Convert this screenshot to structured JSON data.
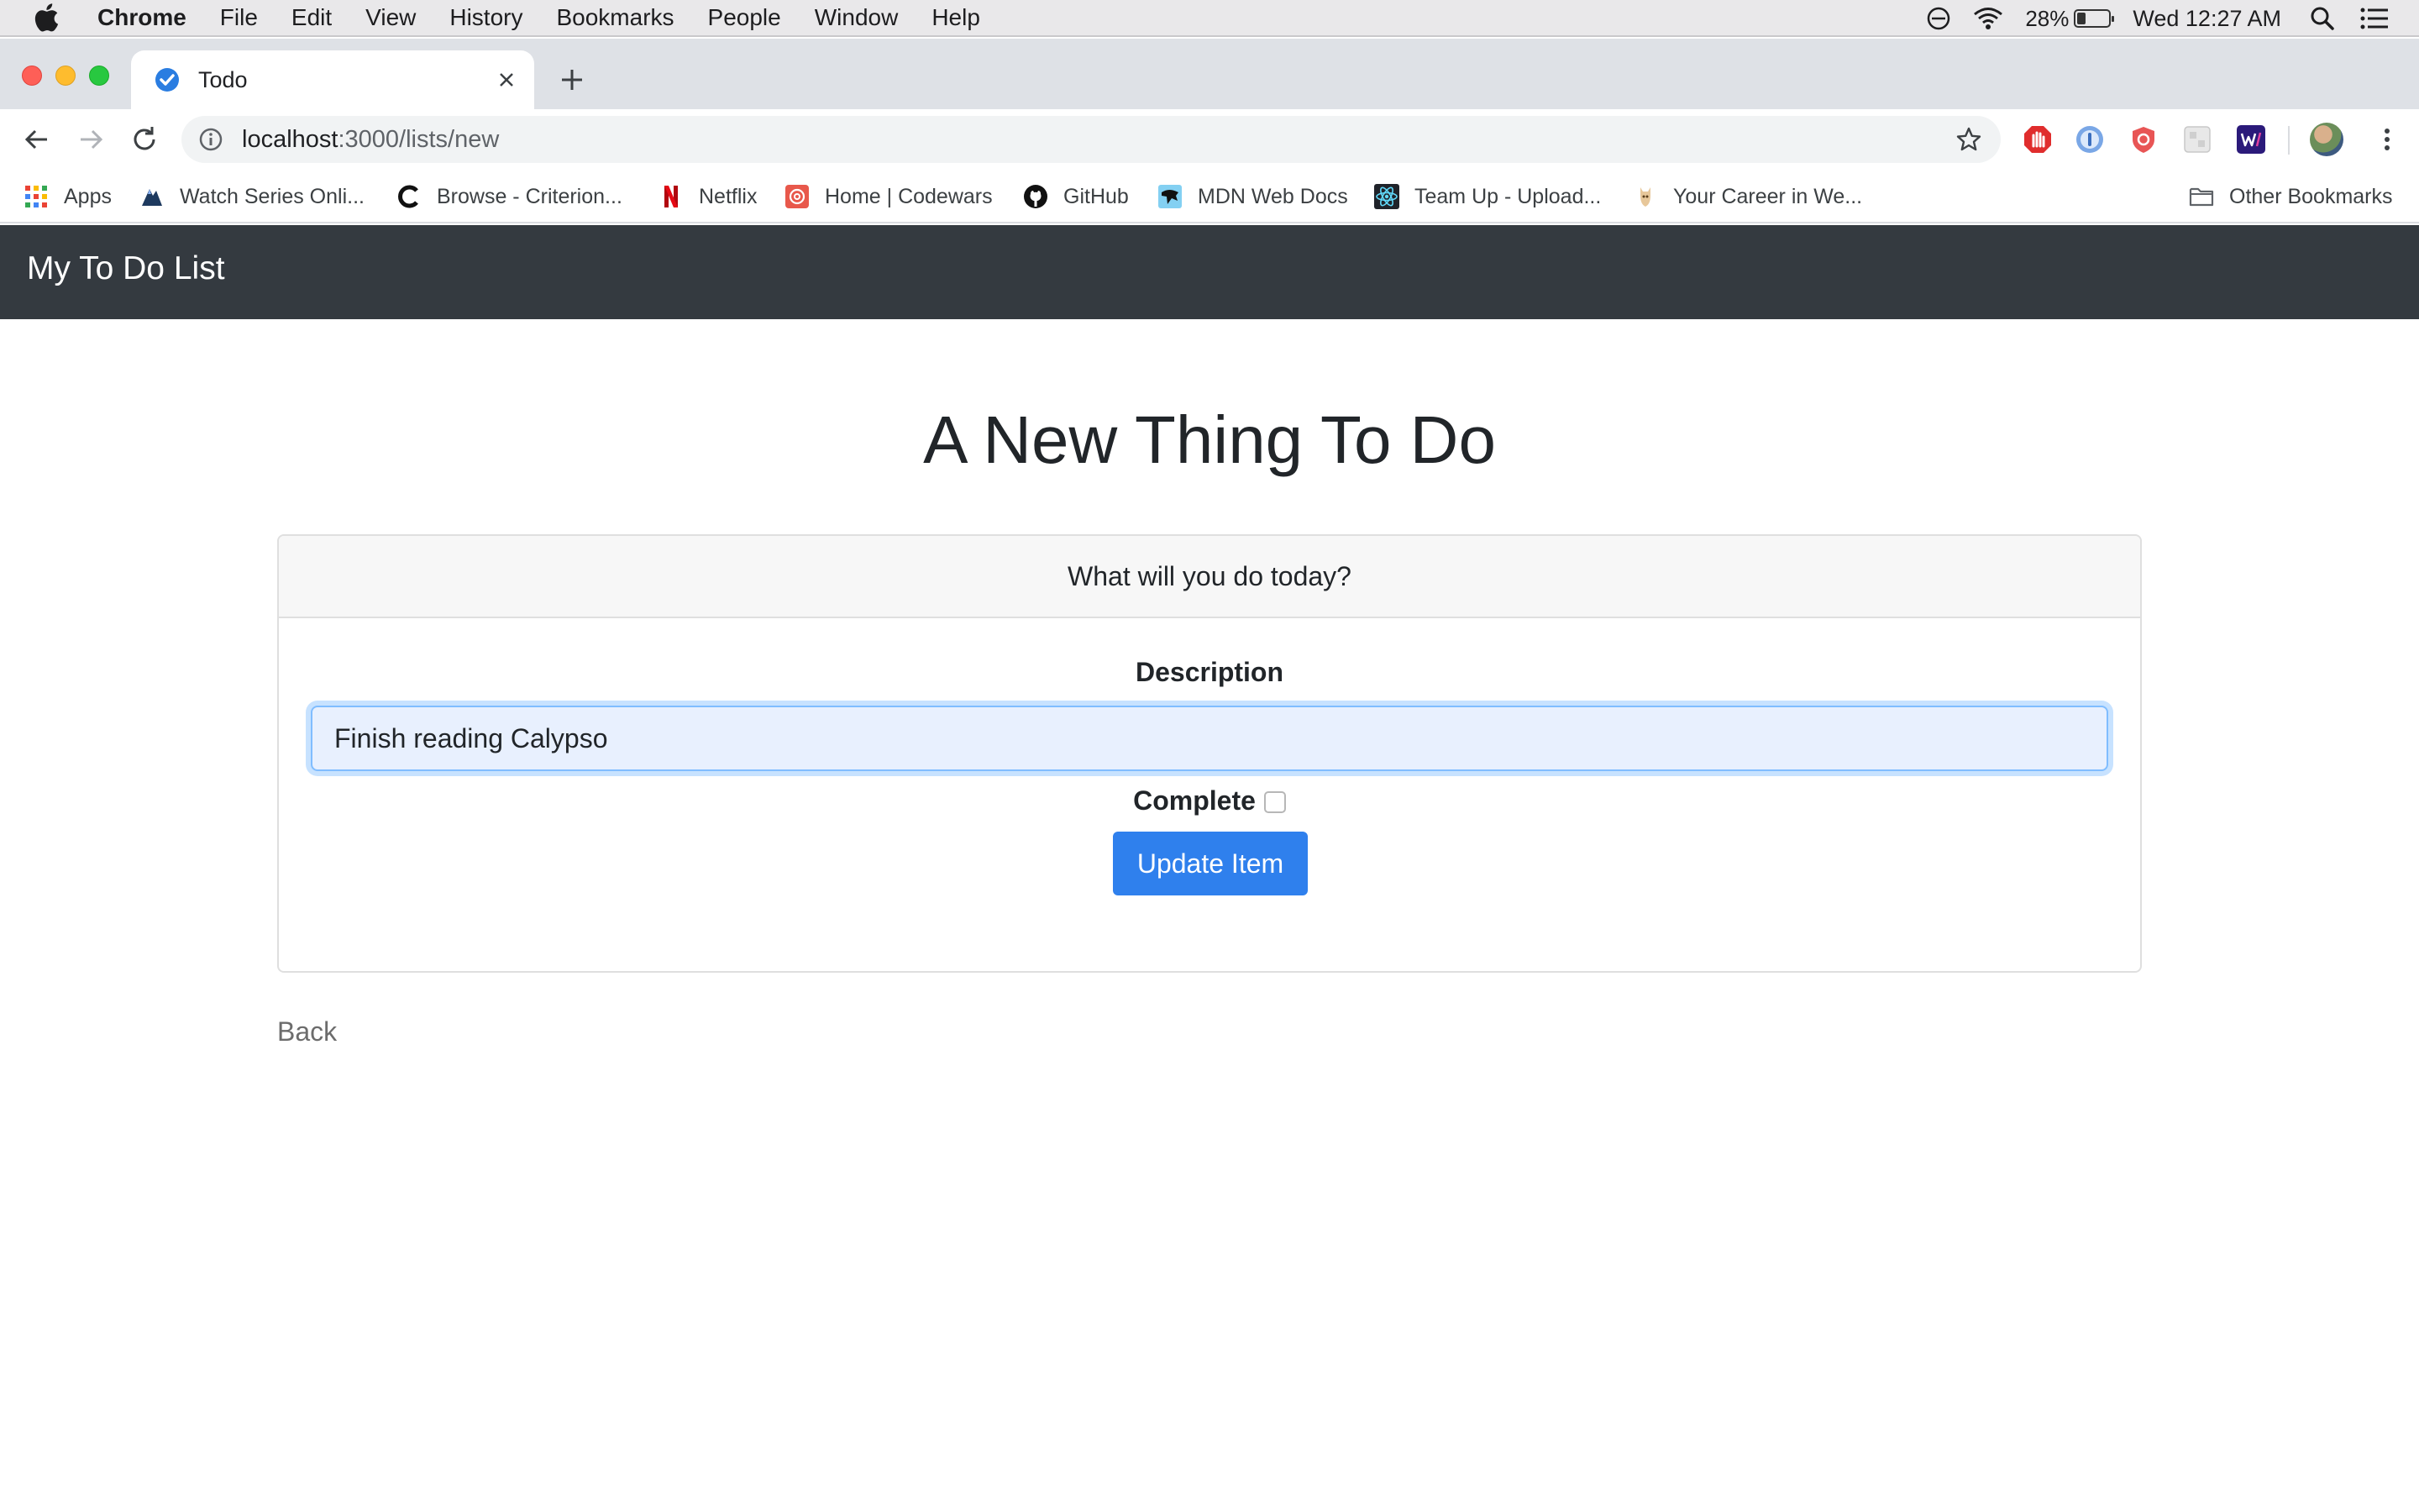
{
  "mac_menubar": {
    "app_name": "Chrome",
    "menus": [
      "File",
      "Edit",
      "View",
      "History",
      "Bookmarks",
      "People",
      "Window",
      "Help"
    ],
    "battery_percent": "28%",
    "battery_level": 0.28,
    "clock": "Wed 12:27 AM"
  },
  "browser": {
    "tab_title": "Todo",
    "url_host": "localhost",
    "url_path": ":3000/lists/new",
    "bookmarks": [
      {
        "label": "Apps",
        "icon": "apps-grid-icon"
      },
      {
        "label": "Watch Series Onli...",
        "icon": "watch-series-icon"
      },
      {
        "label": "Browse - Criterion...",
        "icon": "criterion-icon"
      },
      {
        "label": "Netflix",
        "icon": "netflix-icon"
      },
      {
        "label": "Home | Codewars",
        "icon": "codewars-icon"
      },
      {
        "label": "GitHub",
        "icon": "github-icon"
      },
      {
        "label": "MDN Web Docs",
        "icon": "mdn-icon"
      },
      {
        "label": "Team Up - Upload...",
        "icon": "react-icon"
      },
      {
        "label": "Your Career in We...",
        "icon": "career-icon"
      }
    ],
    "other_bookmarks": "Other Bookmarks",
    "colors": {
      "tabstrip": "#dee1e6",
      "navbar": "#343a40",
      "button": "#2f80ed"
    }
  },
  "app": {
    "brand": "My To Do List",
    "page_title": "A New Thing To Do",
    "card_header": "What will you do today?",
    "description_label": "Description",
    "description_value": "Finish reading Calypso",
    "complete_label": "Complete",
    "complete_checked": false,
    "submit_label": "Update Item",
    "back_label": "Back"
  }
}
